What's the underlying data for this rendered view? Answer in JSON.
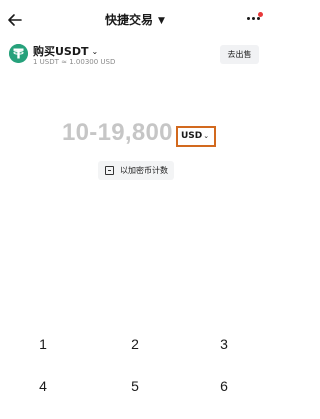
{
  "nav": {
    "title": "快捷交易",
    "back_icon": "arrow-left-icon",
    "more_icon": "more-dots-icon",
    "dropdown_icon": "caret-down-icon"
  },
  "asset": {
    "title": "购买USDT",
    "rate": "1 USDT ≈ 1.00300 USD",
    "sell_label": "去出售",
    "icon": "tether-icon"
  },
  "amount": {
    "range": "10-19,800",
    "currency": "USD"
  },
  "toggle": {
    "label": "以加密币计数",
    "icon": "toggle-unit-icon"
  },
  "keypad": {
    "keys": [
      "1",
      "2",
      "3",
      "4",
      "5",
      "6"
    ]
  },
  "colors": {
    "accent_border": "#d2691e",
    "tether_green": "#26a17b",
    "notification_red": "#e8393a"
  }
}
